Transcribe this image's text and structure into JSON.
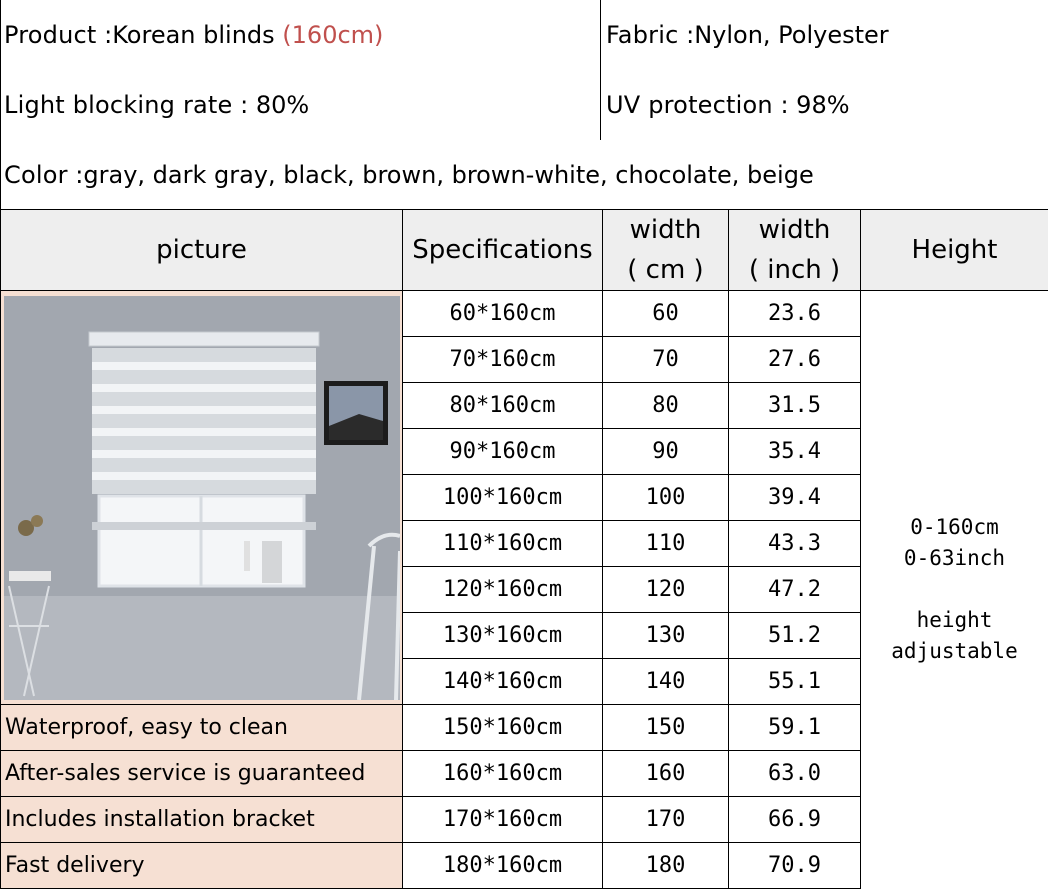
{
  "info": {
    "product_label": "Product",
    "product_value": "Korean blinds",
    "product_size": "(160cm)",
    "fabric_label": "Fabric",
    "fabric_value": "Nylon, Polyester",
    "light_label": "Light blocking rate",
    "light_value": "80%",
    "uv_label": "UV protection",
    "uv_value": "98%",
    "color_label": "Color",
    "color_value": "gray,  dark gray,  black,  brown,  brown-white,  chocolate,  beige"
  },
  "headers": {
    "picture": "picture",
    "specifications": "Specifications",
    "width_cm_1": "width",
    "width_cm_2": "( cm )",
    "width_inch_1": "width",
    "width_inch_2": "( inch )",
    "height": "Height"
  },
  "rows": [
    {
      "spec": "60*160cm",
      "cm": "60",
      "inch": "23.6"
    },
    {
      "spec": "70*160cm",
      "cm": "70",
      "inch": "27.6"
    },
    {
      "spec": "80*160cm",
      "cm": "80",
      "inch": "31.5"
    },
    {
      "spec": "90*160cm",
      "cm": "90",
      "inch": "35.4"
    },
    {
      "spec": "100*160cm",
      "cm": "100",
      "inch": "39.4"
    },
    {
      "spec": "110*160cm",
      "cm": "110",
      "inch": "43.3"
    },
    {
      "spec": "120*160cm",
      "cm": "120",
      "inch": "47.2"
    },
    {
      "spec": "130*160cm",
      "cm": "130",
      "inch": "51.2"
    },
    {
      "spec": "140*160cm",
      "cm": "140",
      "inch": "55.1"
    },
    {
      "spec": "150*160cm",
      "cm": "150",
      "inch": "59.1"
    },
    {
      "spec": "160*160cm",
      "cm": "160",
      "inch": "63.0"
    },
    {
      "spec": "170*160cm",
      "cm": "170",
      "inch": "66.9"
    },
    {
      "spec": "180*160cm",
      "cm": "180",
      "inch": "70.9"
    }
  ],
  "features": [
    "Waterproof, easy to clean",
    "After-sales service is guaranteed",
    "Includes installation bracket",
    "Fast delivery"
  ],
  "height_range": {
    "cm": "0-160cm",
    "inch": "0-63inch",
    "note_1": "height",
    "note_2": "adjustable"
  },
  "colors": {
    "highlight": "#c0504d",
    "header_bg": "#eeeeee",
    "feature_bg": "#f6e0d3"
  }
}
